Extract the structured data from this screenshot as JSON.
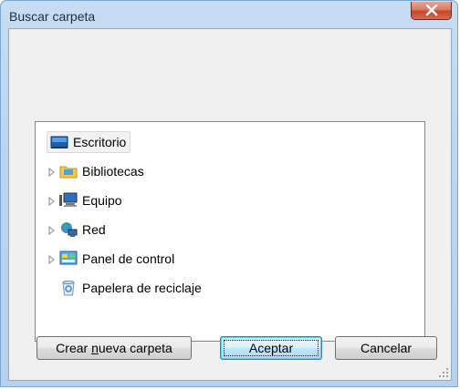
{
  "window": {
    "title": "Buscar carpeta"
  },
  "tree": {
    "items": [
      {
        "label": "Escritorio",
        "icon": "desktop-icon",
        "expandable": false,
        "selected": true
      },
      {
        "label": "Bibliotecas",
        "icon": "libraries-folder-icon",
        "expandable": true
      },
      {
        "label": "Equipo",
        "icon": "computer-icon",
        "expandable": true
      },
      {
        "label": "Red",
        "icon": "network-icon",
        "expandable": true
      },
      {
        "label": "Panel de control",
        "icon": "control-panel-icon",
        "expandable": true
      },
      {
        "label": "Papelera de reciclaje",
        "icon": "recycle-bin-icon",
        "expandable": false
      }
    ]
  },
  "buttons": {
    "new_folder_pre": "Crear ",
    "new_folder_mnemonic": "n",
    "new_folder_post": "ueva carpeta",
    "ok": "Aceptar",
    "cancel": "Cancelar"
  },
  "colors": {
    "frame": "#bcd5ee",
    "close_button": "#c7462c",
    "client_bg": "#f0f0f0",
    "selection_bg": "#f2f2f2"
  }
}
